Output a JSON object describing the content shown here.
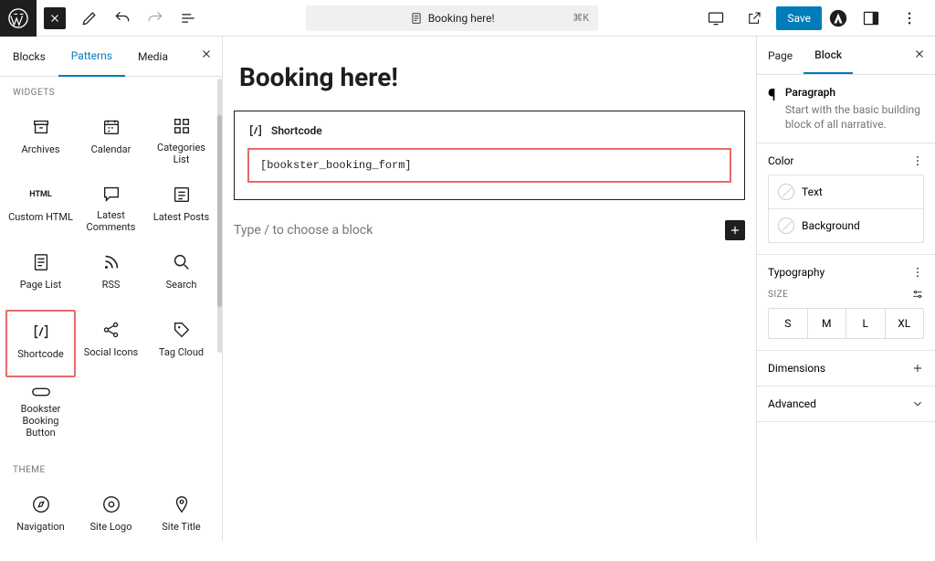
{
  "topbar": {
    "doc_title": "Booking here!",
    "kbd_hint": "⌘K",
    "save_label": "Save"
  },
  "left": {
    "tabs": [
      "Blocks",
      "Patterns",
      "Media"
    ],
    "active_tab": "Patterns",
    "sections": {
      "widgets": "WIDGETS",
      "theme": "THEME"
    },
    "widgets": [
      {
        "label": "Archives",
        "icon": "archive-icon"
      },
      {
        "label": "Calendar",
        "icon": "calendar-icon"
      },
      {
        "label": "Categories List",
        "icon": "grid-icon"
      },
      {
        "label": "Custom HTML",
        "icon": "html-icon"
      },
      {
        "label": "Latest Comments",
        "icon": "comment-icon"
      },
      {
        "label": "Latest Posts",
        "icon": "posts-icon"
      },
      {
        "label": "Page List",
        "icon": "pagelist-icon"
      },
      {
        "label": "RSS",
        "icon": "rss-icon"
      },
      {
        "label": "Search",
        "icon": "search-icon"
      },
      {
        "label": "Shortcode",
        "icon": "shortcode-icon"
      },
      {
        "label": "Social Icons",
        "icon": "share-icon"
      },
      {
        "label": "Tag Cloud",
        "icon": "tag-icon"
      },
      {
        "label": "Bookster Booking Button",
        "icon": "button-icon"
      }
    ],
    "theme": [
      {
        "label": "Navigation",
        "icon": "compass-icon"
      },
      {
        "label": "Site Logo",
        "icon": "sitelogo-icon"
      },
      {
        "label": "Site Title",
        "icon": "pin-icon"
      }
    ]
  },
  "editor": {
    "page_title": "Booking here!",
    "shortcode_label": "Shortcode",
    "shortcode_value": "[bookster_booking_form]",
    "prompt": "Type / to choose a block"
  },
  "right": {
    "tabs": [
      "Page",
      "Block"
    ],
    "active_tab": "Block",
    "paragraph_title": "Paragraph",
    "paragraph_desc": "Start with the basic building block of all narrative.",
    "color_title": "Color",
    "color_items": [
      "Text",
      "Background"
    ],
    "typography_title": "Typography",
    "size_label": "SIZE",
    "sizes": [
      "S",
      "M",
      "L",
      "XL"
    ],
    "dimensions_title": "Dimensions",
    "advanced_title": "Advanced"
  }
}
